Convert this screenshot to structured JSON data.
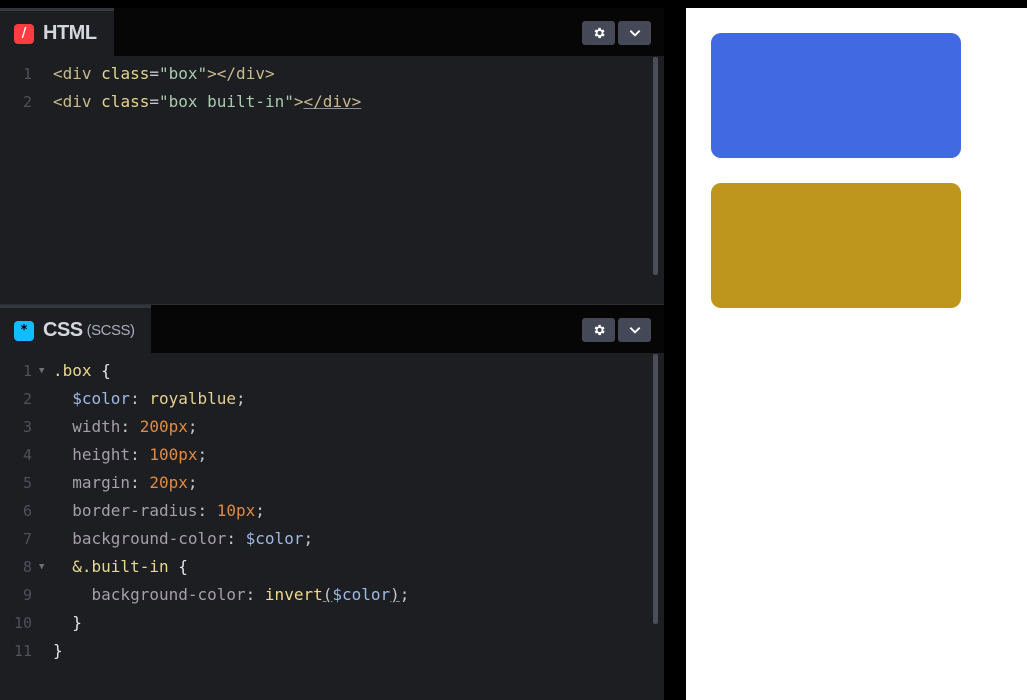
{
  "html_panel": {
    "title": "HTML",
    "icon": "/",
    "icon_color": "#ff3c41",
    "lines": [
      {
        "num": "1",
        "tokens": [
          {
            "t": "<div ",
            "c": "t-tag"
          },
          {
            "t": "class",
            "c": "t-attr"
          },
          {
            "t": "=",
            "c": "t-eq"
          },
          {
            "t": "\"box\"",
            "c": "t-str"
          },
          {
            "t": "></div>",
            "c": "t-tag"
          }
        ]
      },
      {
        "num": "2",
        "tokens": [
          {
            "t": "<div ",
            "c": "t-tag"
          },
          {
            "t": "class",
            "c": "t-attr"
          },
          {
            "t": "=",
            "c": "t-eq"
          },
          {
            "t": "\"box built-in\"",
            "c": "t-str"
          },
          {
            "t": ">",
            "c": "t-tag"
          },
          {
            "t": "</div>",
            "c": "t-tag u"
          }
        ]
      }
    ]
  },
  "css_panel": {
    "title": "CSS",
    "subtitle": "(SCSS)",
    "icon": "*",
    "icon_color": "#0ebeff",
    "lines": [
      {
        "num": "1",
        "fold": true,
        "tokens": [
          {
            "t": ".box ",
            "c": "t-sel"
          },
          {
            "t": "{",
            "c": "t-brace"
          }
        ]
      },
      {
        "num": "2",
        "tokens": [
          {
            "t": "  $color",
            "c": "t-var"
          },
          {
            "t": ": ",
            "c": "t-eq"
          },
          {
            "t": "royalblue",
            "c": "t-val"
          },
          {
            "t": ";",
            "c": "t-eq"
          }
        ]
      },
      {
        "num": "3",
        "tokens": [
          {
            "t": "  width",
            "c": "t-prop"
          },
          {
            "t": ": ",
            "c": "t-eq"
          },
          {
            "t": "200px",
            "c": "t-num"
          },
          {
            "t": ";",
            "c": "t-eq"
          }
        ]
      },
      {
        "num": "4",
        "tokens": [
          {
            "t": "  height",
            "c": "t-prop"
          },
          {
            "t": ": ",
            "c": "t-eq"
          },
          {
            "t": "100px",
            "c": "t-num"
          },
          {
            "t": ";",
            "c": "t-eq"
          }
        ]
      },
      {
        "num": "5",
        "tokens": [
          {
            "t": "  margin",
            "c": "t-prop"
          },
          {
            "t": ": ",
            "c": "t-eq"
          },
          {
            "t": "20px",
            "c": "t-num"
          },
          {
            "t": ";",
            "c": "t-eq"
          }
        ]
      },
      {
        "num": "6",
        "tokens": [
          {
            "t": "  border-radius",
            "c": "t-prop"
          },
          {
            "t": ": ",
            "c": "t-eq"
          },
          {
            "t": "10px",
            "c": "t-num"
          },
          {
            "t": ";",
            "c": "t-eq"
          }
        ]
      },
      {
        "num": "7",
        "tokens": [
          {
            "t": "  background-color",
            "c": "t-prop"
          },
          {
            "t": ": ",
            "c": "t-eq"
          },
          {
            "t": "$color",
            "c": "t-var"
          },
          {
            "t": ";",
            "c": "t-eq"
          }
        ]
      },
      {
        "num": "8",
        "fold": true,
        "tokens": [
          {
            "t": "  &.built-in ",
            "c": "t-sel"
          },
          {
            "t": "{",
            "c": "t-brace"
          }
        ]
      },
      {
        "num": "9",
        "tokens": [
          {
            "t": "    background-color",
            "c": "t-prop"
          },
          {
            "t": ": ",
            "c": "t-eq"
          },
          {
            "t": "invert",
            "c": "t-fn"
          },
          {
            "t": "(",
            "c": "t-eq u"
          },
          {
            "t": "$color",
            "c": "t-var"
          },
          {
            "t": ")",
            "c": "t-eq u"
          },
          {
            "t": ";",
            "c": "t-eq"
          }
        ]
      },
      {
        "num": "10",
        "tokens": [
          {
            "t": "  }",
            "c": "t-brace"
          }
        ]
      },
      {
        "num": "11",
        "tokens": [
          {
            "t": "}",
            "c": "t-brace"
          }
        ]
      }
    ]
  },
  "preview": {
    "boxes": [
      {
        "name": "box",
        "color": "#4169e1"
      },
      {
        "name": "box built-in",
        "color": "#be961e"
      }
    ]
  }
}
